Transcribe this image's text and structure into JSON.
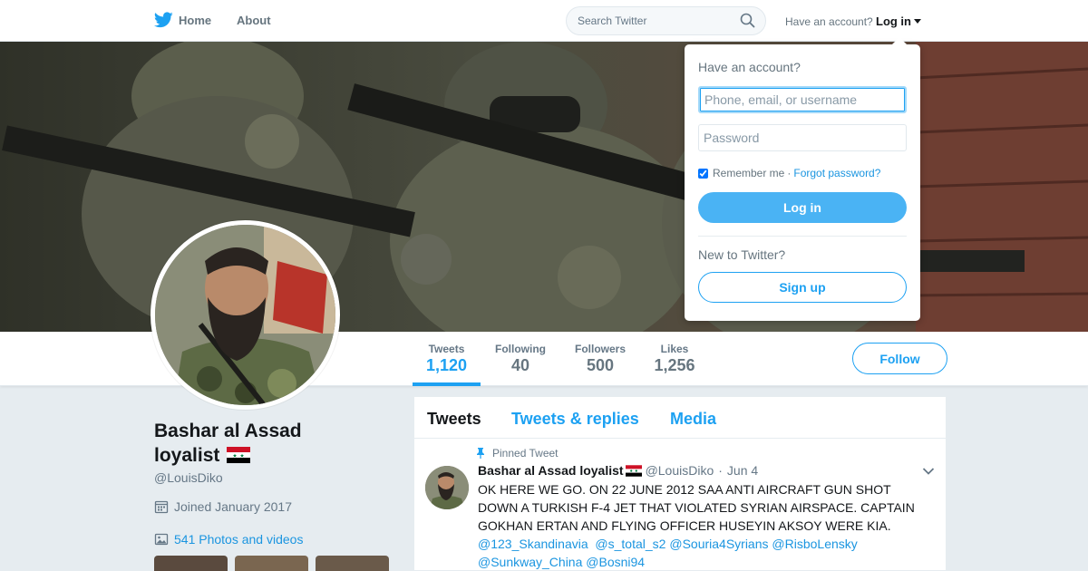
{
  "nav": {
    "home_label": "Home",
    "about_label": "About",
    "search_placeholder": "Search Twitter",
    "have_account": "Have an account?",
    "login_label": "Log in"
  },
  "profile": {
    "name": "Bashar al Assad loyalist",
    "handle": "@LouisDiko",
    "joined": "Joined January 2017",
    "photos_link": "541 Photos and videos",
    "follow_label": "Follow"
  },
  "stats": [
    {
      "label": "Tweets",
      "value": "1,120"
    },
    {
      "label": "Following",
      "value": "40"
    },
    {
      "label": "Followers",
      "value": "500"
    },
    {
      "label": "Likes",
      "value": "1,256"
    }
  ],
  "timeline": {
    "tabs": [
      "Tweets",
      "Tweets & replies",
      "Media"
    ],
    "pinned_label": "Pinned Tweet",
    "tweet": {
      "name": "Bashar al Assad loyalist",
      "handle": "@LouisDiko",
      "date": "Jun 4",
      "text": "OK HERE WE GO.  ON 22 JUNE 2012 SAA ANTI AIRCRAFT GUN SHOT DOWN A TURKISH F-4 JET THAT VIOLATED SYRIAN AIRSPACE. CAPTAIN GOKHAN ERTAN AND FLYING OFFICER HUSEYIN AKSOY WERE KIA.",
      "mentions": [
        "@123_Skandinavia",
        "@s_total_s2",
        "@Souria4Syrians",
        "@RisboLensky",
        "@Sunkway_China",
        "@Bosni94"
      ]
    }
  },
  "login_dropdown": {
    "title": "Have an account?",
    "phone_placeholder": "Phone, email, or username",
    "password_placeholder": "Password",
    "remember_label": "Remember me",
    "separator": "·",
    "forgot_label": "Forgot password?",
    "login_button": "Log in",
    "new_label": "New to Twitter?",
    "signup_button": "Sign up"
  },
  "colors": {
    "brand": "#1da1f2",
    "link": "#1b95e0",
    "login_button": "#4ab3f4",
    "page_bg": "#e6ecf0"
  },
  "icons": [
    "twitter-bird-icon",
    "search-icon",
    "calendar-icon",
    "photo-icon",
    "pin-icon",
    "chevron-down-icon",
    "syria-flag-icon"
  ]
}
